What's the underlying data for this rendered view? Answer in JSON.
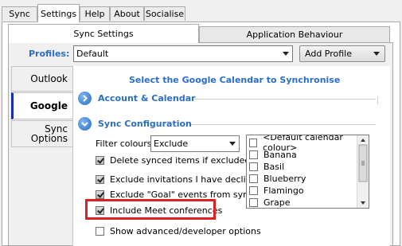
{
  "main_tabs": [
    "Sync",
    "Settings",
    "Help",
    "About",
    "Socialise"
  ],
  "active_main_tab": "Settings",
  "sub_tabs": [
    "Sync Settings",
    "Application Behaviour"
  ],
  "profiles": {
    "label": "Profiles:",
    "selected": "Default",
    "add_button": "Add Profile"
  },
  "side_tabs": [
    "Outlook",
    "Google",
    "Sync\nOptions"
  ],
  "active_side_tab": "Google",
  "content": {
    "title": "Select the Google Calendar to Synchronise",
    "account_section": "Account & Calendar",
    "sync_section": "Sync Configuration",
    "filter_label": "Filter colours",
    "filter_value": "Exclude",
    "options": [
      {
        "label": "Delete synced items if excluded",
        "checked": true
      },
      {
        "label": "Exclude invitations I have declined",
        "checked": true
      },
      {
        "label": "Exclude \"Goal\" events from sync",
        "checked": true
      },
      {
        "label": "Include Meet conferences",
        "checked": true
      },
      {
        "label": "Show advanced/developer options",
        "checked": false
      }
    ],
    "calendar_colours": [
      "<Default calendar colour>",
      "Banana",
      "Basil",
      "Blueberry",
      "Flamingo",
      "Grape"
    ]
  },
  "colors": {
    "accent": "#2a6ec8",
    "highlight_box": "#e02020"
  }
}
